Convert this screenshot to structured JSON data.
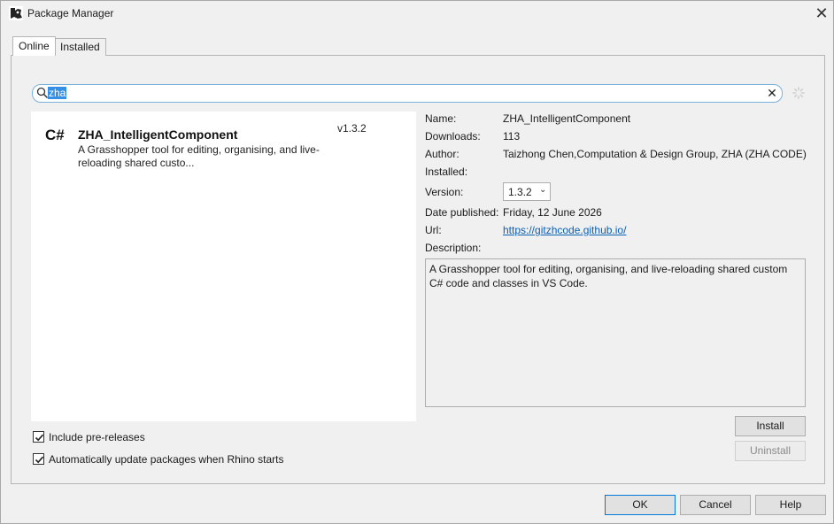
{
  "window": {
    "title": "Package Manager"
  },
  "tabs": [
    {
      "label": "Online"
    },
    {
      "label": "Installed"
    }
  ],
  "search": {
    "value": "zha"
  },
  "packages": [
    {
      "lang": "C#",
      "name": "ZHA_IntelligentComponent",
      "version": "v1.3.2",
      "description": "A Grasshopper tool for editing, organising, and live-reloading shared custo..."
    }
  ],
  "details": {
    "name_label": "Name:",
    "name_value": "ZHA_IntelligentComponent",
    "downloads_label": "Downloads:",
    "downloads_value": "113",
    "author_label": "Author:",
    "author_value": "Taizhong Chen,Computation & Design Group, ZHA (ZHA CODE)",
    "installed_label": "Installed:",
    "version_label": "Version:",
    "version_value": "1.3.2",
    "date_label": "Date published:",
    "date_value": "Friday, 12 June 2026",
    "url_label": "Url:",
    "url_value": "https://gitzhcode.github.io/",
    "description_label": "Description:",
    "description_value": "A Grasshopper tool for editing, organising, and live-reloading shared custom C# code and classes in VS Code."
  },
  "actions": {
    "install": "Install",
    "uninstall": "Uninstall"
  },
  "options": {
    "include_prereleases": "Include pre-releases",
    "auto_update": "Automatically update packages when Rhino starts"
  },
  "footer": {
    "ok": "OK",
    "cancel": "Cancel",
    "help": "Help"
  },
  "colors": {
    "accent": "#0078d7",
    "link": "#0b5fb3",
    "selection": "#3390e6"
  }
}
